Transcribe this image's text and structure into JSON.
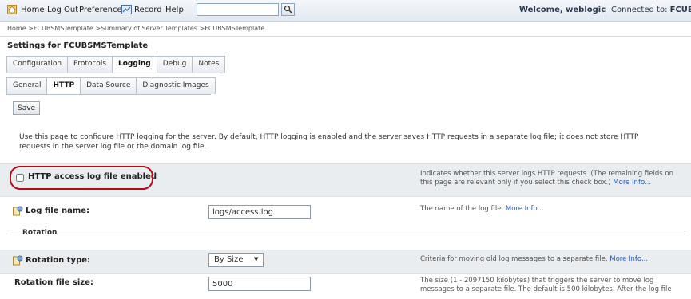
{
  "topbar": {
    "links": {
      "home": "Home",
      "logout": "Log Out",
      "preferences": "Preferences",
      "record": "Record",
      "help": "Help"
    },
    "search_value": "",
    "welcome": "Welcome, weblogic",
    "connected_label": "Connected to:",
    "connected_domain": "FCUBSDoma"
  },
  "breadcrumb": "Home >FCUBSMSTemplate >Summary of Server Templates >FCUBSMSTemplate",
  "page_title": "Settings for FCUBSMSTemplate",
  "tabs_primary": [
    "Configuration",
    "Protocols",
    "Logging",
    "Debug",
    "Notes"
  ],
  "tabs_secondary": [
    "General",
    "HTTP",
    "Data Source",
    "Diagnostic Images"
  ],
  "save_label": "Save",
  "description": "Use this page to configure HTTP logging for the server. By default, HTTP logging is enabled and the server saves HTTP requests in a separate log file; it does not store HTTP requests in the server log file or the domain log file.",
  "fields": {
    "access_log": {
      "label": "HTTP access log file enabled",
      "checked": false,
      "help": "Indicates whether this server logs HTTP requests. (The remaining fields on this page are relevant only if you select this check box.)",
      "more": "More Info..."
    },
    "log_file": {
      "label": "Log file name:",
      "value": "logs/access.log",
      "help": "The name of the log file.",
      "more": "More Info..."
    },
    "rotation_legend": "Rotation",
    "rotation_type": {
      "label": "Rotation type:",
      "value": "By Size",
      "help": "Criteria for moving old log messages to a separate file.",
      "more": "More Info..."
    },
    "rotation_size": {
      "label": "Rotation file size:",
      "value": "5000",
      "help": "The size (1 - 2097150 kilobytes) that triggers the server to move log messages to a separate file. The default is 500 kilobytes. After the log file"
    }
  },
  "colors": {
    "highlight": "#b00c18",
    "link": "#2a5aa8"
  },
  "icons": [
    "home-icon",
    "record-icon",
    "search-icon",
    "property-icon"
  ]
}
